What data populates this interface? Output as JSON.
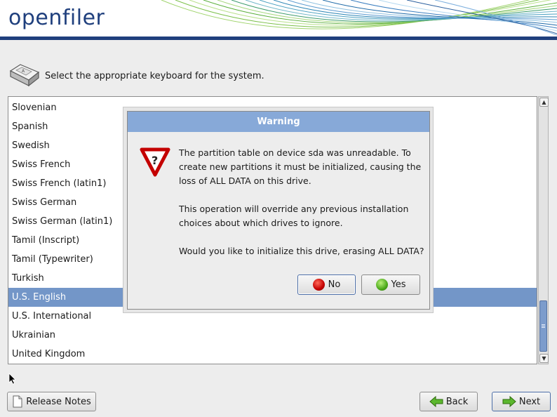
{
  "header": {
    "logo_text": "openfiler"
  },
  "prompt": {
    "text": "Select the appropriate keyboard for the system."
  },
  "keyboard_list": {
    "items": [
      "Slovenian",
      "Spanish",
      "Swedish",
      "Swiss French",
      "Swiss French (latin1)",
      "Swiss German",
      "Swiss German (latin1)",
      "Tamil (Inscript)",
      "Tamil (Typewriter)",
      "Turkish",
      "U.S. English",
      "U.S. International",
      "Ukrainian",
      "United Kingdom"
    ],
    "selected": "U.S. English"
  },
  "dialog": {
    "title": "Warning",
    "message_1": "The partition table on device sda was unreadable. To create new partitions it must be initialized, causing the loss of ALL DATA on this drive.",
    "message_2": "This operation will override any previous installation choices about which drives to ignore.",
    "message_3": "Would you like to initialize this drive, erasing ALL DATA?",
    "no_label": "No",
    "yes_label": "Yes"
  },
  "buttons": {
    "release_notes": "Release Notes",
    "back": "Back",
    "next": "Next"
  },
  "colors": {
    "brand": "#1f3f7d",
    "selection": "#7396c8",
    "dialog_title": "#87a9d8"
  }
}
